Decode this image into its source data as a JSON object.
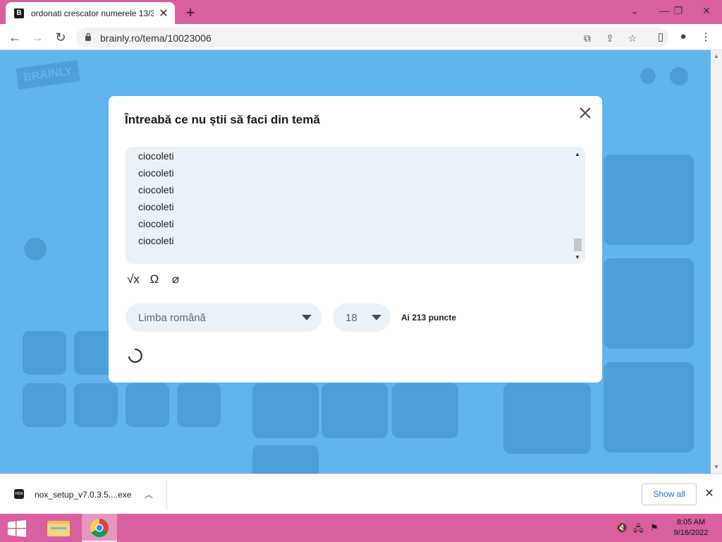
{
  "browser": {
    "tab_title": "ordonati crescator numerele 13/3",
    "tab_favicon_letter": "B",
    "url": "brainly.ro/tema/10023006"
  },
  "modal": {
    "title": "Întreabă ce nu știi să faci din temă",
    "question_lines": [
      "ciocoleti",
      "ciocoleti",
      "ciocoleti",
      "ciocoleti",
      "ciocoleti",
      "ciocoleti"
    ],
    "tools": [
      "square-root-icon",
      "omega-icon",
      "paperclip-icon"
    ],
    "subject_value": "Limba română",
    "points_offer_value": "18",
    "points_balance": "Ai 213 puncte"
  },
  "download_bar": {
    "file_name": "nox_setup_v7.0.3.5....exe",
    "show_all_label": "Show all"
  },
  "taskbar": {
    "time": "8:05 AM",
    "date": "9/16/2022"
  },
  "colors": {
    "accent_pink": "#d8609f",
    "page_overlay_blue": "#62b4ef",
    "textarea_bg": "#ebf2f7"
  }
}
